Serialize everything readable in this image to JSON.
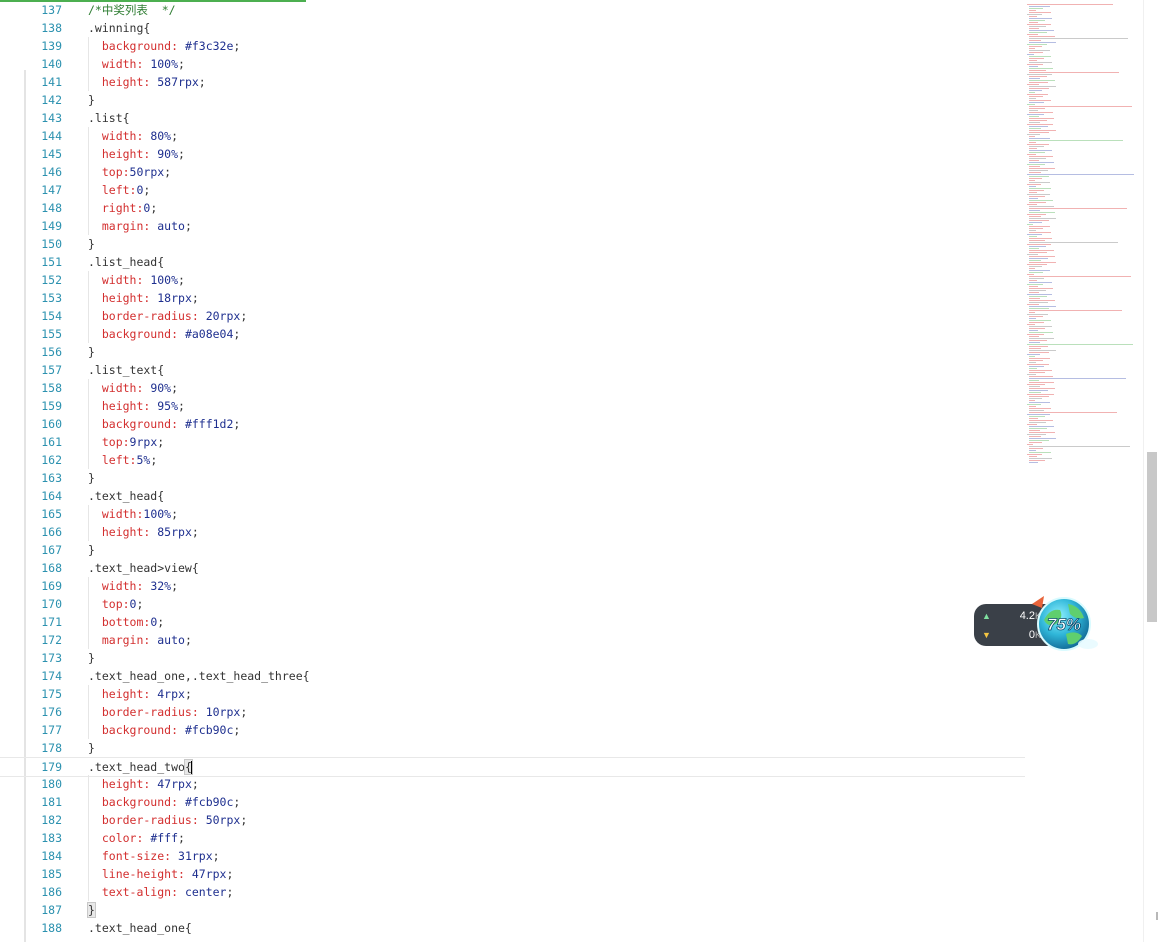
{
  "editor": {
    "lines": [
      {
        "n": "137",
        "tokens": [
          {
            "t": "/*中奖列表  */",
            "c": "tok-comment"
          }
        ]
      },
      {
        "n": "138",
        "tokens": [
          {
            "t": ".winning{",
            "c": "tok-sel"
          }
        ]
      },
      {
        "n": "139",
        "tokens": [
          {
            "t": "  background: ",
            "c": "tok-prop"
          },
          {
            "t": "#f3c32e",
            "c": "tok-val"
          },
          {
            "t": ";",
            "c": "tok-sel"
          }
        ]
      },
      {
        "n": "140",
        "tokens": [
          {
            "t": "  width: ",
            "c": "tok-prop"
          },
          {
            "t": "100%",
            "c": "tok-val"
          },
          {
            "t": ";",
            "c": "tok-sel"
          }
        ]
      },
      {
        "n": "141",
        "tokens": [
          {
            "t": "  height: ",
            "c": "tok-prop"
          },
          {
            "t": "587rpx",
            "c": "tok-val"
          },
          {
            "t": ";",
            "c": "tok-sel"
          }
        ]
      },
      {
        "n": "142",
        "tokens": [
          {
            "t": "}",
            "c": "tok-sel"
          }
        ]
      },
      {
        "n": "143",
        "tokens": [
          {
            "t": ".list{",
            "c": "tok-sel"
          }
        ]
      },
      {
        "n": "144",
        "tokens": [
          {
            "t": "  width: ",
            "c": "tok-prop"
          },
          {
            "t": "80%",
            "c": "tok-val"
          },
          {
            "t": ";",
            "c": "tok-sel"
          }
        ]
      },
      {
        "n": "145",
        "tokens": [
          {
            "t": "  height: ",
            "c": "tok-prop"
          },
          {
            "t": "90%",
            "c": "tok-val"
          },
          {
            "t": ";",
            "c": "tok-sel"
          }
        ]
      },
      {
        "n": "146",
        "tokens": [
          {
            "t": "  top:",
            "c": "tok-prop"
          },
          {
            "t": "50rpx",
            "c": "tok-val"
          },
          {
            "t": ";",
            "c": "tok-sel"
          }
        ]
      },
      {
        "n": "147",
        "tokens": [
          {
            "t": "  left:",
            "c": "tok-prop"
          },
          {
            "t": "0",
            "c": "tok-val"
          },
          {
            "t": ";",
            "c": "tok-sel"
          }
        ]
      },
      {
        "n": "148",
        "tokens": [
          {
            "t": "  right:",
            "c": "tok-prop"
          },
          {
            "t": "0",
            "c": "tok-val"
          },
          {
            "t": ";",
            "c": "tok-sel"
          }
        ]
      },
      {
        "n": "149",
        "tokens": [
          {
            "t": "  margin: ",
            "c": "tok-prop"
          },
          {
            "t": "auto",
            "c": "tok-val"
          },
          {
            "t": ";",
            "c": "tok-sel"
          }
        ]
      },
      {
        "n": "150",
        "tokens": [
          {
            "t": "}",
            "c": "tok-sel"
          }
        ]
      },
      {
        "n": "151",
        "tokens": [
          {
            "t": ".list_head{",
            "c": "tok-sel"
          }
        ]
      },
      {
        "n": "152",
        "tokens": [
          {
            "t": "  width: ",
            "c": "tok-prop"
          },
          {
            "t": "100%",
            "c": "tok-val"
          },
          {
            "t": ";",
            "c": "tok-sel"
          }
        ]
      },
      {
        "n": "153",
        "tokens": [
          {
            "t": "  height: ",
            "c": "tok-prop"
          },
          {
            "t": "18rpx",
            "c": "tok-val"
          },
          {
            "t": ";",
            "c": "tok-sel"
          }
        ]
      },
      {
        "n": "154",
        "tokens": [
          {
            "t": "  border-radius: ",
            "c": "tok-prop"
          },
          {
            "t": "20rpx",
            "c": "tok-val"
          },
          {
            "t": ";",
            "c": "tok-sel"
          }
        ]
      },
      {
        "n": "155",
        "tokens": [
          {
            "t": "  background: ",
            "c": "tok-prop"
          },
          {
            "t": "#a08e04",
            "c": "tok-val"
          },
          {
            "t": ";",
            "c": "tok-sel"
          }
        ]
      },
      {
        "n": "156",
        "tokens": [
          {
            "t": "}",
            "c": "tok-sel"
          }
        ]
      },
      {
        "n": "157",
        "tokens": [
          {
            "t": ".list_text{",
            "c": "tok-sel"
          }
        ]
      },
      {
        "n": "158",
        "tokens": [
          {
            "t": "  width: ",
            "c": "tok-prop"
          },
          {
            "t": "90%",
            "c": "tok-val"
          },
          {
            "t": ";",
            "c": "tok-sel"
          }
        ]
      },
      {
        "n": "159",
        "tokens": [
          {
            "t": "  height: ",
            "c": "tok-prop"
          },
          {
            "t": "95%",
            "c": "tok-val"
          },
          {
            "t": ";",
            "c": "tok-sel"
          }
        ]
      },
      {
        "n": "160",
        "tokens": [
          {
            "t": "  background: ",
            "c": "tok-prop"
          },
          {
            "t": "#fff1d2",
            "c": "tok-val"
          },
          {
            "t": ";",
            "c": "tok-sel"
          }
        ]
      },
      {
        "n": "161",
        "tokens": [
          {
            "t": "  top:",
            "c": "tok-prop"
          },
          {
            "t": "9rpx",
            "c": "tok-val"
          },
          {
            "t": ";",
            "c": "tok-sel"
          }
        ]
      },
      {
        "n": "162",
        "tokens": [
          {
            "t": "  left:",
            "c": "tok-prop"
          },
          {
            "t": "5%",
            "c": "tok-val"
          },
          {
            "t": ";",
            "c": "tok-sel"
          }
        ]
      },
      {
        "n": "163",
        "tokens": [
          {
            "t": "}",
            "c": "tok-sel"
          }
        ]
      },
      {
        "n": "164",
        "tokens": [
          {
            "t": ".text_head{",
            "c": "tok-sel"
          }
        ]
      },
      {
        "n": "165",
        "tokens": [
          {
            "t": "  width:",
            "c": "tok-prop"
          },
          {
            "t": "100%",
            "c": "tok-val"
          },
          {
            "t": ";",
            "c": "tok-sel"
          }
        ]
      },
      {
        "n": "166",
        "tokens": [
          {
            "t": "  height: ",
            "c": "tok-prop"
          },
          {
            "t": "85rpx",
            "c": "tok-val"
          },
          {
            "t": ";",
            "c": "tok-sel"
          }
        ]
      },
      {
        "n": "167",
        "tokens": [
          {
            "t": "}",
            "c": "tok-sel"
          }
        ]
      },
      {
        "n": "168",
        "tokens": [
          {
            "t": ".text_head>view{",
            "c": "tok-sel"
          }
        ]
      },
      {
        "n": "169",
        "tokens": [
          {
            "t": "  width: ",
            "c": "tok-prop"
          },
          {
            "t": "32%",
            "c": "tok-val"
          },
          {
            "t": ";",
            "c": "tok-sel"
          }
        ]
      },
      {
        "n": "170",
        "tokens": [
          {
            "t": "  top:",
            "c": "tok-prop"
          },
          {
            "t": "0",
            "c": "tok-val"
          },
          {
            "t": ";",
            "c": "tok-sel"
          }
        ]
      },
      {
        "n": "171",
        "tokens": [
          {
            "t": "  bottom:",
            "c": "tok-prop"
          },
          {
            "t": "0",
            "c": "tok-val"
          },
          {
            "t": ";",
            "c": "tok-sel"
          }
        ]
      },
      {
        "n": "172",
        "tokens": [
          {
            "t": "  margin: ",
            "c": "tok-prop"
          },
          {
            "t": "auto",
            "c": "tok-val"
          },
          {
            "t": ";",
            "c": "tok-sel"
          }
        ]
      },
      {
        "n": "173",
        "tokens": [
          {
            "t": "}",
            "c": "tok-sel"
          }
        ]
      },
      {
        "n": "174",
        "tokens": [
          {
            "t": ".text_head_one,.text_head_three{",
            "c": "tok-sel"
          }
        ]
      },
      {
        "n": "175",
        "tokens": [
          {
            "t": "  height: ",
            "c": "tok-prop"
          },
          {
            "t": "4rpx",
            "c": "tok-val"
          },
          {
            "t": ";",
            "c": "tok-sel"
          }
        ]
      },
      {
        "n": "176",
        "tokens": [
          {
            "t": "  border-radius: ",
            "c": "tok-prop"
          },
          {
            "t": "10rpx",
            "c": "tok-val"
          },
          {
            "t": ";",
            "c": "tok-sel"
          }
        ]
      },
      {
        "n": "177",
        "tokens": [
          {
            "t": "  background: ",
            "c": "tok-prop"
          },
          {
            "t": "#fcb90c",
            "c": "tok-val"
          },
          {
            "t": ";",
            "c": "tok-sel"
          }
        ]
      },
      {
        "n": "178",
        "tokens": [
          {
            "t": "}",
            "c": "tok-sel"
          }
        ]
      },
      {
        "n": "179",
        "tokens": [
          {
            "t": ".text_head_two",
            "c": "tok-sel"
          },
          {
            "t": "{",
            "c": "tok-sel brace-hl",
            "cursor": true
          }
        ],
        "current": true
      },
      {
        "n": "180",
        "tokens": [
          {
            "t": "  height: ",
            "c": "tok-prop"
          },
          {
            "t": "47rpx",
            "c": "tok-val"
          },
          {
            "t": ";",
            "c": "tok-sel"
          }
        ]
      },
      {
        "n": "181",
        "tokens": [
          {
            "t": "  background: ",
            "c": "tok-prop"
          },
          {
            "t": "#fcb90c",
            "c": "tok-val"
          },
          {
            "t": ";",
            "c": "tok-sel"
          }
        ]
      },
      {
        "n": "182",
        "tokens": [
          {
            "t": "  border-radius: ",
            "c": "tok-prop"
          },
          {
            "t": "50rpx",
            "c": "tok-val"
          },
          {
            "t": ";",
            "c": "tok-sel"
          }
        ]
      },
      {
        "n": "183",
        "tokens": [
          {
            "t": "  color: ",
            "c": "tok-prop"
          },
          {
            "t": "#fff",
            "c": "tok-val"
          },
          {
            "t": ";",
            "c": "tok-sel"
          }
        ]
      },
      {
        "n": "184",
        "tokens": [
          {
            "t": "  font-size: ",
            "c": "tok-prop"
          },
          {
            "t": "31rpx",
            "c": "tok-val"
          },
          {
            "t": ";",
            "c": "tok-sel"
          }
        ]
      },
      {
        "n": "185",
        "tokens": [
          {
            "t": "  line-height: ",
            "c": "tok-prop"
          },
          {
            "t": "47rpx",
            "c": "tok-val"
          },
          {
            "t": ";",
            "c": "tok-sel"
          }
        ]
      },
      {
        "n": "186",
        "tokens": [
          {
            "t": "  text-align: ",
            "c": "tok-prop"
          },
          {
            "t": "center",
            "c": "tok-val"
          },
          {
            "t": ";",
            "c": "tok-sel"
          }
        ]
      },
      {
        "n": "187",
        "tokens": [
          {
            "t": "}",
            "c": "tok-sel brace-hl"
          }
        ]
      },
      {
        "n": "188",
        "tokens": [
          {
            "t": ".text_head_one{",
            "c": "tok-sel"
          }
        ]
      }
    ]
  },
  "netspeed_widget": {
    "upload_value": "4.2",
    "upload_unit": "K/s",
    "download_value": "0",
    "download_unit": "K/s",
    "percent": "75%",
    "upload_arrow_icon": "arrow-up-icon",
    "download_arrow_icon": "arrow-down-icon"
  },
  "colors": {
    "line_number": "#2b91af",
    "property": "#d32f2f",
    "value": "#1e2f8f",
    "comment": "#2e7d32",
    "progress_accent": "#4caf50",
    "widget_bg": "#3a4048"
  },
  "progress": {
    "loading_fraction": 0.264
  },
  "scroll": {
    "thumb_position_fraction": 0.48,
    "thumb_size_fraction": 0.18
  }
}
